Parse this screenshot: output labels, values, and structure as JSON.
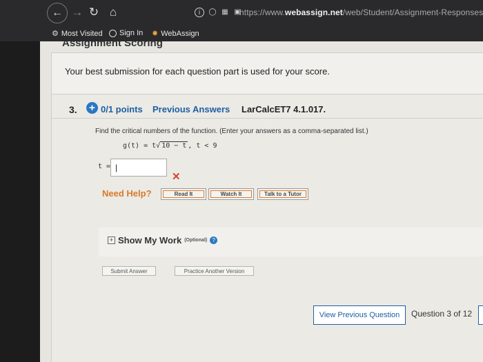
{
  "browser": {
    "url_prefix": "https://www.",
    "url_domain": "webassign.net",
    "url_path": "/web/Student/Assignment-Responses/s"
  },
  "bookmarks": {
    "most_visited": "Most Visited",
    "sign_in": "Sign In",
    "webassign": "WebAssign"
  },
  "page": {
    "heading": "Assignment Scoring",
    "best_submission": "Your best submission for each question part is used for your score."
  },
  "question": {
    "number": "3.",
    "points": "0/1 points",
    "previous_answers": "Previous Answers",
    "code": "LarCalcET7 4.1.017.",
    "instructions": "Find the critical numbers of the function. (Enter your answers as a comma-separated list.)",
    "func_lhs": "g(t) = t",
    "func_radicand": "10 − t",
    "func_condition": ",   t < 9",
    "answer_label": "t =",
    "answer_value": "|",
    "wrong_mark": "✕"
  },
  "help": {
    "label": "Need Help?",
    "read": "Read It",
    "watch": "Watch It",
    "tutor": "Talk to a Tutor"
  },
  "work": {
    "label": "Show My Work",
    "optional": "(Optional)",
    "info": "?"
  },
  "actions": {
    "submit": "Submit Answer",
    "practice": "Practice Another Version",
    "view_previous": "View Previous Question",
    "counter": "Question 3 of 12"
  }
}
